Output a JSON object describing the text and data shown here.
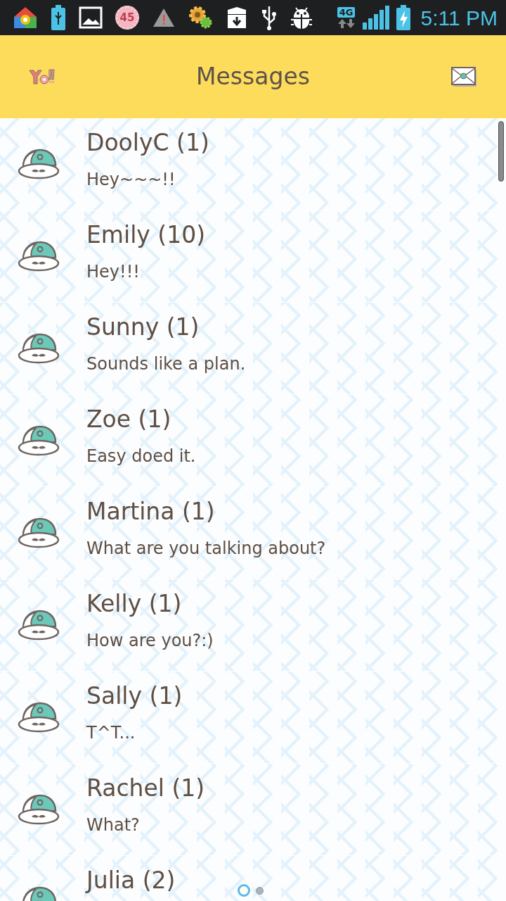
{
  "status_bar": {
    "network": "4G",
    "time": "5:11 PM",
    "notification_count": "45"
  },
  "header": {
    "title": "Messages"
  },
  "conversations": [
    {
      "name": "DoolyC (1)",
      "message": "Hey~~~!!"
    },
    {
      "name": "Emily (10)",
      "message": "Hey!!!"
    },
    {
      "name": "Sunny (1)",
      "message": "Sounds like a plan."
    },
    {
      "name": "Zoe (1)",
      "message": "Easy doed it."
    },
    {
      "name": "Martina (1)",
      "message": "What are you talking about?"
    },
    {
      "name": "Kelly (1)",
      "message": "How are you?:)"
    },
    {
      "name": "Sally (1)",
      "message": "T^T..."
    },
    {
      "name": "Rachel (1)",
      "message": "What?"
    },
    {
      "name": "Julia (2)"
    }
  ],
  "pager": [
    {
      "selected": true
    },
    {
      "selected": false
    }
  ]
}
